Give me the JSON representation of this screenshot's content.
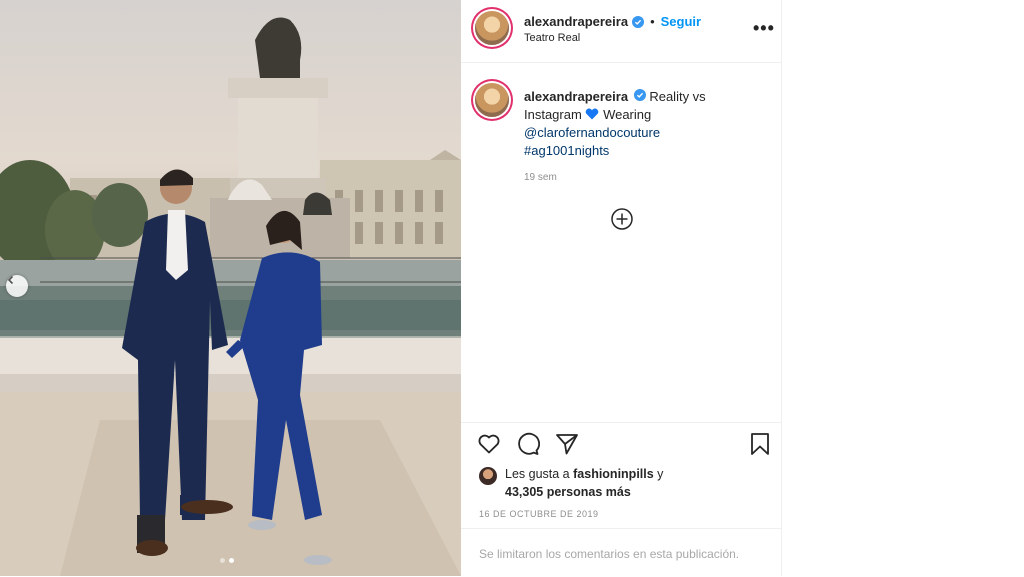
{
  "post": {
    "username": "alexandrapereira",
    "follow_label": "Seguir",
    "separator": "•",
    "location": "Teatro Real",
    "more_label": "•••",
    "caption_text": "Reality vs Instagram",
    "caption_wearing": "Wearing",
    "caption_mention": "@clarofernandocouture",
    "caption_hashtag": "#ag1001nights",
    "time_ago": "19 sem",
    "likes_prefix": "Les gusta a",
    "likes_user": "fashioninpills",
    "likes_suffix": "y",
    "likes_count_text": "43,305 personas más",
    "date": "16 DE OCTUBRE DE 2019",
    "comments_disabled": "Se limitaron los comentarios en esta publicación."
  },
  "colors": {
    "follow": "#0095f6",
    "verified": "#3897f0",
    "link": "#00376b",
    "muted": "#8e8e8e",
    "heart_emoji": "#1877f2"
  },
  "carousel": {
    "slides": 2,
    "active": 2
  },
  "icons": [
    "verified-badge-icon",
    "more-options-icon",
    "add-comment-icon",
    "like-heart-icon",
    "comment-bubble-icon",
    "share-paper-plane-icon",
    "bookmark-icon",
    "carousel-prev-icon",
    "blue-heart-emoji-icon"
  ]
}
